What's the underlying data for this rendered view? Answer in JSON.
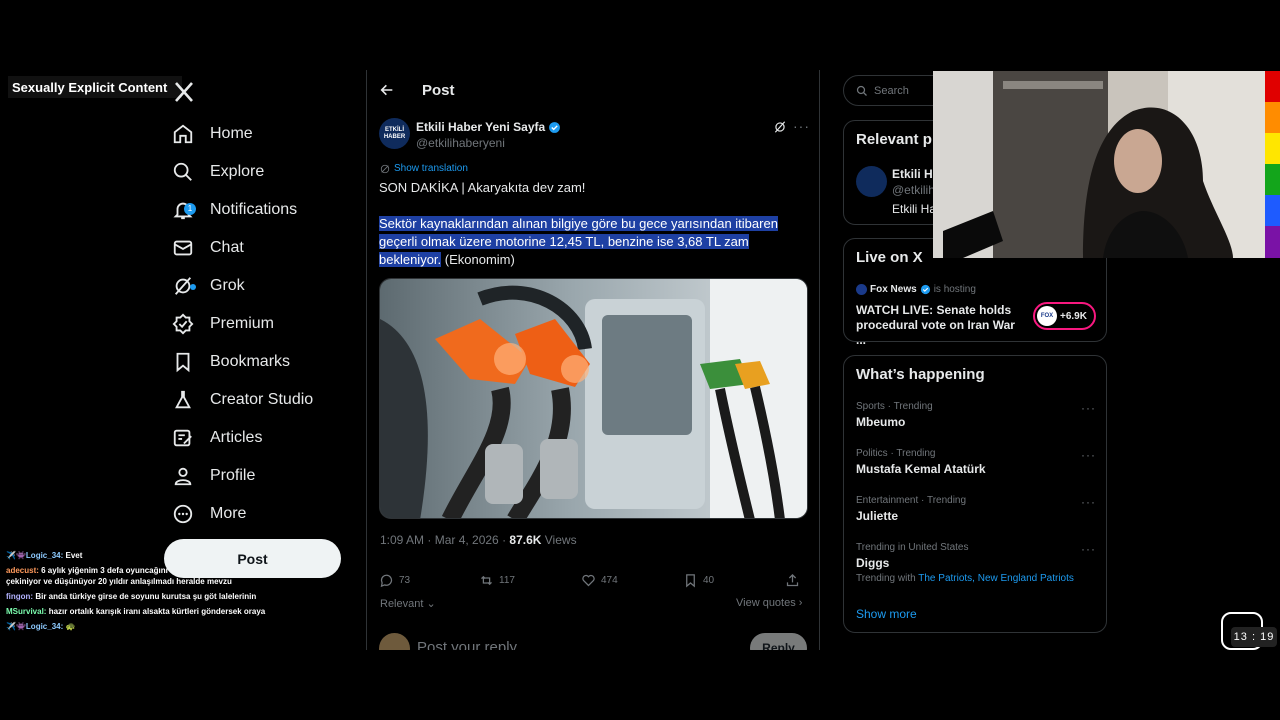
{
  "overlay": {
    "nsfw_label": "Sexually Explicit Content",
    "timer": "13 : 19"
  },
  "nav": {
    "items": [
      {
        "label": "Home",
        "icon": "home-icon"
      },
      {
        "label": "Explore",
        "icon": "search-icon"
      },
      {
        "label": "Notifications",
        "icon": "bell-icon"
      },
      {
        "label": "Chat",
        "icon": "envelope-icon"
      },
      {
        "label": "Grok",
        "icon": "grok-icon"
      },
      {
        "label": "Premium",
        "icon": "premium-icon"
      },
      {
        "label": "Bookmarks",
        "icon": "bookmark-icon"
      },
      {
        "label": "Creator Studio",
        "icon": "flask-icon"
      },
      {
        "label": "Articles",
        "icon": "article-icon"
      },
      {
        "label": "Profile",
        "icon": "person-icon"
      },
      {
        "label": "More",
        "icon": "more-circle-icon"
      }
    ],
    "notifications_badge": "1",
    "post_button": "Post"
  },
  "chat": {
    "messages": [
      {
        "user": "✈️👾Logic_34:",
        "text": " Evet",
        "color": "#8ecbff"
      },
      {
        "user": "adecust:",
        "text": " 6 aylık yiğenim 3 defa oyuncağını ... oyuncagını uzatınca çekiniyor ve düşünüyor 20 yıldır anlaşılmadı heralde mevzu",
        "color": "#ff9a5c"
      },
      {
        "user": "fingon:",
        "text": " Bir anda türkiye girse de soyunu kurutsa şu göt lalelerinin",
        "color": "#b3b3ff"
      },
      {
        "user": "MSurvival:",
        "text": " hazır ortalık karışık iranı alsakta kürtleri göndersek oraya",
        "color": "#7dffb0"
      },
      {
        "user": "✈️👾Logic_34:",
        "text": " 🐢",
        "color": "#8ecbff"
      }
    ]
  },
  "post_view": {
    "title": "Post",
    "author_name": "Etkili Haber Yeni Sayfa",
    "author_handle": "@etkilihaberyeni",
    "avatar_text": "ETKİLİ HABER",
    "show_translation": "Show translation",
    "headline": "SON DAKİKA | Akaryakıta dev zam!",
    "body_highlighted": "Sektör kaynaklarından alınan bilgiye göre bu gece yarısından itibaren geçerli olmak üzere motorine 12,45 TL, benzine ise 3,68 TL zam bekleniyor.",
    "body_source": " (Ekonomim)",
    "timestamp": "1:09 AM · Mar 4, 2026 · ",
    "views_count": "87.6K",
    "views_label": " Views",
    "replies": "73",
    "reposts": "117",
    "likes": "474",
    "bookmarks": "40",
    "sort_label": "Relevant",
    "view_quotes": "View quotes",
    "reply_placeholder": "Post your reply",
    "reply_button": "Reply"
  },
  "sidebar": {
    "search_placeholder": "Search",
    "relevant_title": "Relevant p",
    "relevant_name": "Etkili Ha",
    "relevant_handle": "@etkilih",
    "relevant_bio": "Etkili Ha",
    "live_title": "Live on X",
    "live_host": "Fox News",
    "live_hosting": "is hosting",
    "live_text": "WATCH LIVE: Senate holds procedural vote on Iran War ...",
    "live_count": "+6.9K",
    "happening_title": "What’s happening",
    "trends": [
      {
        "category": "Sports · Trending",
        "name": "Mbeumo",
        "with": ""
      },
      {
        "category": "Politics · Trending",
        "name": "Mustafa Kemal Atatürk",
        "with": ""
      },
      {
        "category": "Entertainment · Trending",
        "name": "Juliette",
        "with": ""
      },
      {
        "category": "Trending in United States",
        "name": "Diggs",
        "with": "The Patriots, New England Patriots"
      }
    ],
    "trending_with_label": "Trending with ",
    "show_more": "Show more"
  },
  "colors": {
    "accent": "#1d9bf0",
    "highlight": "#1e40a3",
    "rainbow": [
      "#e00000",
      "#ff8c00",
      "#ffe600",
      "#13a51b",
      "#1e5bff",
      "#7a12a6"
    ]
  }
}
